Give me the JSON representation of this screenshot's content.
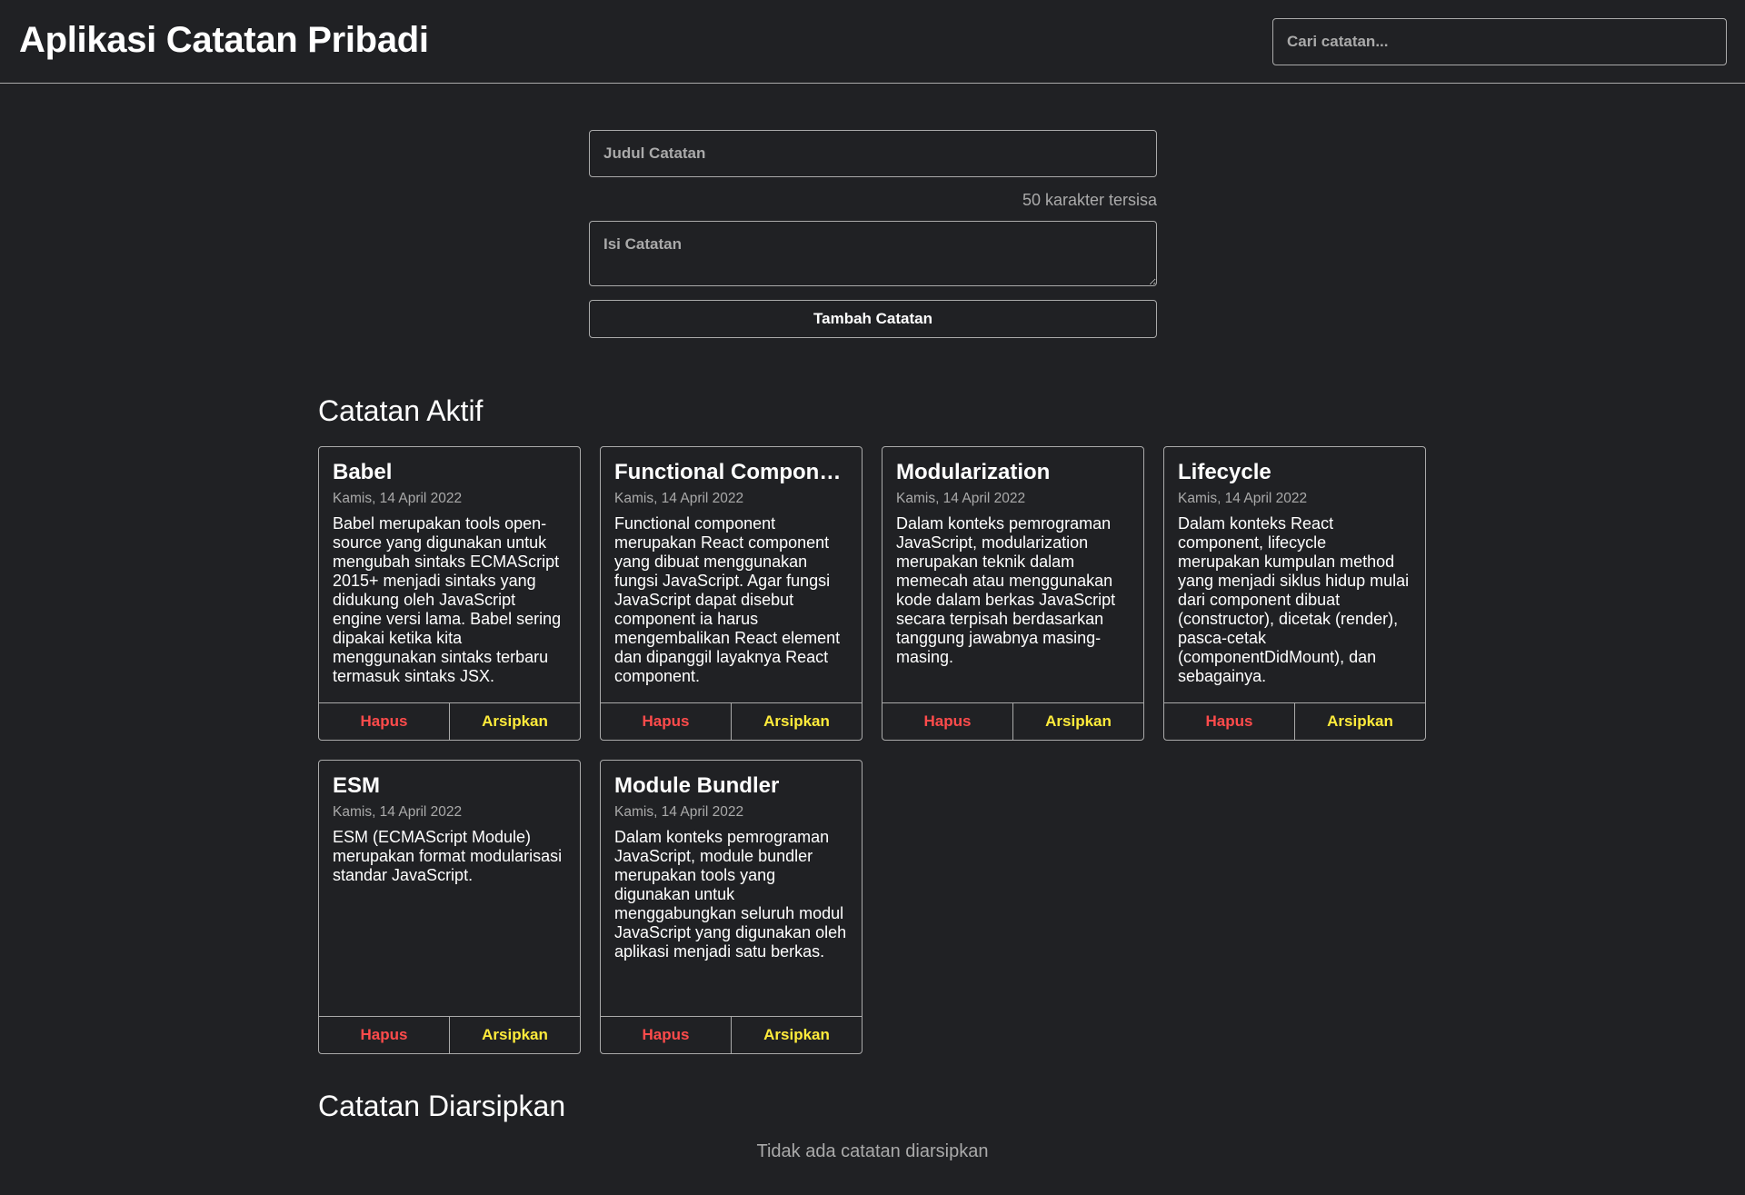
{
  "header": {
    "title": "Aplikasi Catatan Pribadi",
    "search_placeholder": "Cari catatan..."
  },
  "form": {
    "title_placeholder": "Judul Catatan",
    "char_counter": "50 karakter tersisa",
    "body_placeholder": "Isi Catatan",
    "submit_label": "Tambah Catatan"
  },
  "active": {
    "heading": "Catatan Aktif",
    "notes": [
      {
        "title": "Babel",
        "date": "Kamis, 14 April 2022",
        "body": "Babel merupakan tools open-source yang digunakan untuk mengubah sintaks ECMAScript 2015+ menjadi sintaks yang didukung oleh JavaScript engine versi lama. Babel sering dipakai ketika kita menggunakan sintaks terbaru termasuk sintaks JSX.",
        "delete": "Hapus",
        "archive": "Arsipkan"
      },
      {
        "title": "Functional Component",
        "date": "Kamis, 14 April 2022",
        "body": "Functional component merupakan React component yang dibuat menggunakan fungsi JavaScript. Agar fungsi JavaScript dapat disebut component ia harus mengembalikan React element dan dipanggil layaknya React component.",
        "delete": "Hapus",
        "archive": "Arsipkan"
      },
      {
        "title": "Modularization",
        "date": "Kamis, 14 April 2022",
        "body": "Dalam konteks pemrograman JavaScript, modularization merupakan teknik dalam memecah atau menggunakan kode dalam berkas JavaScript secara terpisah berdasarkan tanggung jawabnya masing-masing.",
        "delete": "Hapus",
        "archive": "Arsipkan"
      },
      {
        "title": "Lifecycle",
        "date": "Kamis, 14 April 2022",
        "body": "Dalam konteks React component, lifecycle merupakan kumpulan method yang menjadi siklus hidup mulai dari component dibuat (constructor), dicetak (render), pasca-cetak (componentDidMount), dan sebagainya.",
        "delete": "Hapus",
        "archive": "Arsipkan"
      },
      {
        "title": "ESM",
        "date": "Kamis, 14 April 2022",
        "body": "ESM (ECMAScript Module) merupakan format modularisasi standar JavaScript.",
        "delete": "Hapus",
        "archive": "Arsipkan"
      },
      {
        "title": "Module Bundler",
        "date": "Kamis, 14 April 2022",
        "body": "Dalam konteks pemrograman JavaScript, module bundler merupakan tools yang digunakan untuk menggabungkan seluruh modul JavaScript yang digunakan oleh aplikasi menjadi satu berkas.",
        "delete": "Hapus",
        "archive": "Arsipkan"
      }
    ]
  },
  "archived": {
    "heading": "Catatan Diarsipkan",
    "empty_message": "Tidak ada catatan diarsipkan"
  }
}
